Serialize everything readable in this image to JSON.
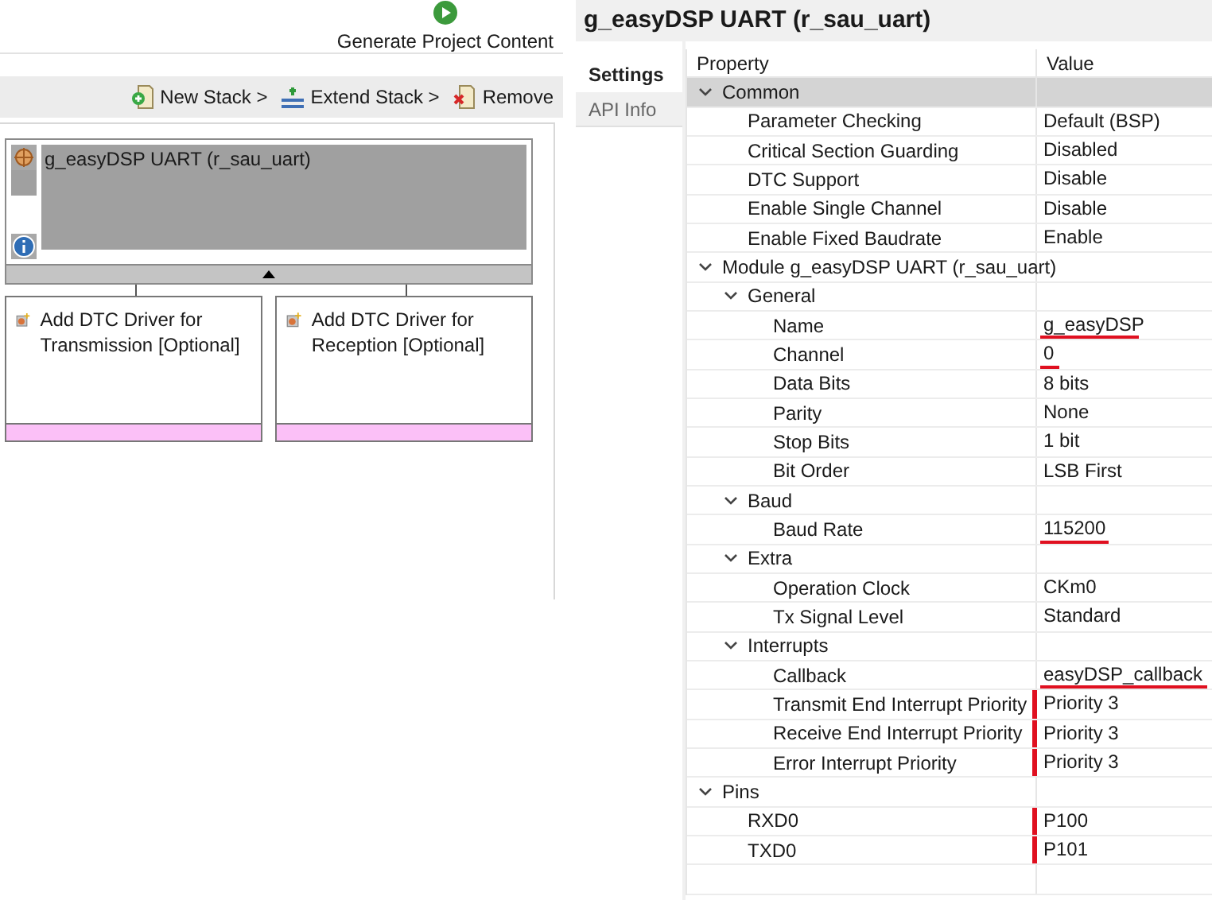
{
  "toolbar_top": {
    "generate_button": "Generate Project Content"
  },
  "stack_toolbar": [
    {
      "label": "New Stack >",
      "kind": "new"
    },
    {
      "label": "Extend Stack >",
      "kind": "extend"
    },
    {
      "label": "Remove",
      "kind": "remove"
    }
  ],
  "stack": {
    "title": "g_easyDSP UART (r_sau_uart)",
    "expanded": true,
    "children": [
      {
        "label": "Add DTC Driver for Transmission [Optional]"
      },
      {
        "label": "Add DTC Driver for Reception [Optional]"
      }
    ]
  },
  "properties_title": "g_easyDSP UART (r_sau_uart)",
  "tabs": [
    {
      "label": "Settings",
      "selected": true
    },
    {
      "label": "API Info",
      "selected": false
    }
  ],
  "table": {
    "columns": [
      "Property",
      "Value"
    ],
    "rows": [
      {
        "property": "Common",
        "expanded": true,
        "selected": true,
        "children": [
          {
            "property": "Parameter Checking",
            "value": "Default (BSP)",
            "underlined": false,
            "side_marked": false
          },
          {
            "property": "Critical Section Guarding",
            "value": "Disabled",
            "underlined": false,
            "side_marked": false
          },
          {
            "property": "DTC Support",
            "value": "Disable",
            "underlined": false,
            "side_marked": false
          },
          {
            "property": "Enable Single Channel",
            "value": "Disable",
            "underlined": false,
            "side_marked": false
          },
          {
            "property": "Enable Fixed Baudrate",
            "value": "Enable",
            "underlined": false,
            "side_marked": false
          }
        ]
      },
      {
        "property": "Module g_easyDSP UART (r_sau_uart)",
        "expanded": true,
        "selected": false,
        "children": [
          {
            "property": "General",
            "expanded": true,
            "selected": false,
            "children": [
              {
                "property": "Name",
                "value": "g_easyDSP",
                "underlined": true,
                "side_marked": false
              },
              {
                "property": "Channel",
                "value": "0",
                "underlined": true,
                "side_marked": false
              },
              {
                "property": "Data Bits",
                "value": "8 bits",
                "underlined": false,
                "side_marked": false
              },
              {
                "property": "Parity",
                "value": "None",
                "underlined": false,
                "side_marked": false
              },
              {
                "property": "Stop Bits",
                "value": "1 bit",
                "underlined": false,
                "side_marked": false
              },
              {
                "property": "Bit Order",
                "value": "LSB First",
                "underlined": false,
                "side_marked": false
              }
            ]
          },
          {
            "property": "Baud",
            "expanded": true,
            "selected": false,
            "children": [
              {
                "property": "Baud Rate",
                "value": "115200",
                "underlined": true,
                "side_marked": false
              }
            ]
          },
          {
            "property": "Extra",
            "expanded": true,
            "selected": false,
            "children": [
              {
                "property": "Operation Clock",
                "value": "CKm0",
                "underlined": false,
                "side_marked": false
              },
              {
                "property": "Tx Signal Level",
                "value": "Standard",
                "underlined": false,
                "side_marked": false
              }
            ]
          },
          {
            "property": "Interrupts",
            "expanded": true,
            "selected": false,
            "children": [
              {
                "property": "Callback",
                "value": "easyDSP_callback",
                "underlined": true,
                "side_marked": false
              },
              {
                "property": "Transmit End Interrupt Priority",
                "value": "Priority 3",
                "underlined": false,
                "side_marked": true
              },
              {
                "property": "Receive End Interrupt Priority",
                "value": "Priority 3",
                "underlined": false,
                "side_marked": true
              },
              {
                "property": "Error Interrupt Priority",
                "value": "Priority 3",
                "underlined": false,
                "side_marked": true
              }
            ]
          }
        ]
      },
      {
        "property": "Pins",
        "expanded": true,
        "selected": false,
        "children": [
          {
            "property": "RXD0",
            "value": "P100",
            "underlined": false,
            "side_marked": true
          },
          {
            "property": "TXD0",
            "value": "P101",
            "underlined": false,
            "side_marked": true
          }
        ]
      }
    ]
  }
}
